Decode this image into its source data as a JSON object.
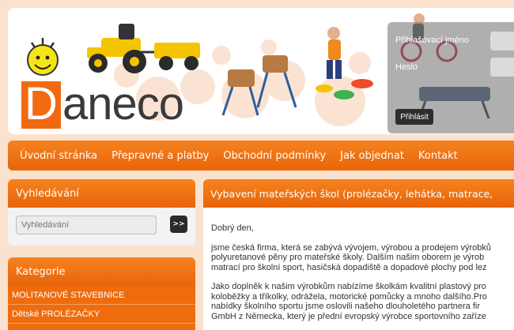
{
  "logo": {
    "letter": "D",
    "rest": "aneco"
  },
  "login": {
    "username_label": "Přihlašovací jméno",
    "password_label": "Heslo",
    "submit_label": "Přihlásit"
  },
  "nav": {
    "items": [
      {
        "label": "Úvodní stránka"
      },
      {
        "label": "Přepravné a platby"
      },
      {
        "label": "Obchodní podmínky"
      },
      {
        "label": "Jak objednat"
      },
      {
        "label": "Kontakt"
      }
    ]
  },
  "search": {
    "title": "Vyhledávání",
    "placeholder": "Vyhledávání",
    "button_label": ">>"
  },
  "categories": {
    "title": "Kategorie",
    "items": [
      {
        "label": "MOLITANOVÉ STAVEBNICE"
      },
      {
        "label": "Dětské PROLÉZAČKY"
      }
    ]
  },
  "content": {
    "title": "Vybavení mateřských škol (prolézačky, lehátka, matrace,",
    "greeting": "Dobrý den,",
    "paragraph1": [
      "jsme česká firma, která se zabývá vývojem, výrobou a prodejem výrobků",
      "polyuretanové pěny pro mateřské školy. Dalším našim oborem je výrob",
      "matrací pro školní sport, hasičská dopadiště a dopadové plochy pod lez"
    ],
    "paragraph2": [
      "Jako doplněk k našim výrobkům nabízíme školkám kvalitní plastový pro",
      "koloběžky a tříkolky, odrážela, motorické pomůcky a mnoho dalšího.Pro",
      "nabídky školního sportu  jsme oslovili našeho dlouholetého partnera fir",
      "GmbH z Německa, který je přední evropský výrobce sportovního zaříze"
    ]
  },
  "colors": {
    "accent": "#f26a10",
    "background": "#fbe2cf"
  }
}
